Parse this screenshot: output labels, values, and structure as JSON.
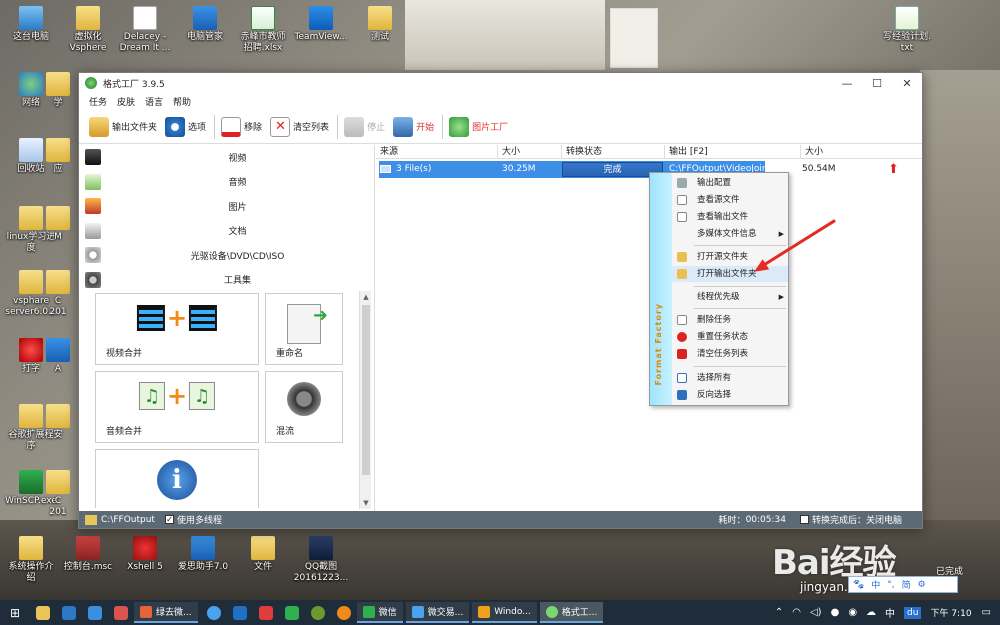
{
  "desktop": {
    "icons": [
      {
        "label": "这台电脑",
        "icon": "computer-icon"
      },
      {
        "label": "虚拟化\nVsphere",
        "icon": "folder-icon"
      },
      {
        "label": "Delacey -\nDream It ...",
        "icon": "mp3-file-icon"
      },
      {
        "label": "电脑管家",
        "icon": "pc-manager-icon"
      },
      {
        "label": "赤峰市教师\n招聘.xlsx",
        "icon": "excel-file-icon"
      },
      {
        "label": "TeamView...",
        "icon": "teamviewer-icon"
      },
      {
        "label": "测试",
        "icon": "folder-icon"
      },
      {
        "label": "写经验计划.\ntxt",
        "icon": "text-file-icon"
      },
      {
        "label": "网络",
        "icon": "network-icon"
      },
      {
        "label": "学",
        "icon": "folder-icon"
      },
      {
        "label": "回收站",
        "icon": "recycle-bin-icon"
      },
      {
        "label": "应",
        "icon": "folder-icon"
      },
      {
        "label": "linux学习进\n度",
        "icon": "folder-icon"
      },
      {
        "label": "M",
        "icon": "folder-icon"
      },
      {
        "label": "vsphare\nserver6.0...",
        "icon": "folder-icon"
      },
      {
        "label": "C\n201",
        "icon": "folder-icon"
      },
      {
        "label": "打字",
        "icon": "typing-app-icon"
      },
      {
        "label": "A",
        "icon": "app-icon"
      },
      {
        "label": "谷歌扩展程\n序",
        "icon": "folder-icon"
      },
      {
        "label": "安",
        "icon": "folder-icon"
      },
      {
        "label": "WinSCP.exe",
        "icon": "winscp-icon"
      },
      {
        "label": "C\n201",
        "icon": "folder-icon"
      },
      {
        "label": "系统操作介\n绍",
        "icon": "folder-icon"
      },
      {
        "label": "控制台.msc",
        "icon": "console-icon"
      },
      {
        "label": "Xshell 5",
        "icon": "xshell-icon"
      },
      {
        "label": "爱思助手7.0",
        "icon": "aisi-icon"
      },
      {
        "label": "文件",
        "icon": "folder-icon"
      },
      {
        "label": "QQ截图\n20161223...",
        "icon": "image-file-icon"
      }
    ]
  },
  "window": {
    "title": "格式工厂 3.9.5",
    "controls": {
      "minimize": "—",
      "maximize": "☐",
      "close": "✕"
    },
    "menu": [
      "任务",
      "皮肤",
      "语言",
      "帮助"
    ],
    "toolbar": {
      "output_folder": "输出文件夹",
      "options": "选项",
      "remove": "移除",
      "clear_list": "清空列表",
      "stop": "停止",
      "start": "开始",
      "picture_factory": "图片工厂"
    },
    "categories": [
      "视频",
      "音频",
      "图片",
      "文档",
      "光驱设备\\DVD\\CD\\ISO",
      "工具集"
    ],
    "tools": [
      {
        "label": "视频合并"
      },
      {
        "label": "重命名"
      },
      {
        "label": "音频合并"
      },
      {
        "label": "混流"
      },
      {
        "label": ""
      }
    ],
    "list": {
      "columns": [
        "来源",
        "大小",
        "转换状态",
        "输出 [F2]",
        "大小"
      ],
      "rows": [
        {
          "source": "3 File(s)",
          "size": "30.25M",
          "status": "完成",
          "output": "C:\\FFOutput\\VideoJoiner1...",
          "output_size": "50.54M"
        }
      ]
    },
    "status_bar": {
      "output_path": "C:\\FFOutput",
      "multithread": "使用多线程",
      "elapsed_label": "耗时：",
      "elapsed": "00:05:34",
      "after_convert": "转换完成后：关闭电脑"
    }
  },
  "context_menu": {
    "brand": "Format Factory",
    "items": [
      {
        "label": "输出配置",
        "icon": "settings-icon"
      },
      {
        "label": "查看源文件",
        "icon": "document-icon"
      },
      {
        "label": "查看输出文件",
        "icon": "document-icon"
      },
      {
        "label": "多媒体文件信息",
        "icon": "none",
        "submenu": true
      },
      {
        "label": "打开源文件夹",
        "icon": "folder-icon"
      },
      {
        "label": "打开输出文件夹",
        "icon": "folder-icon"
      },
      {
        "label": "线程优先级",
        "icon": "none",
        "submenu": true
      },
      {
        "label": "删除任务",
        "icon": "delete-icon"
      },
      {
        "label": "重置任务状态",
        "icon": "reset-icon"
      },
      {
        "label": "清空任务列表",
        "icon": "clear-icon"
      },
      {
        "label": "选择所有",
        "icon": "select-all-icon"
      },
      {
        "label": "反向选择",
        "icon": "invert-select-icon"
      }
    ]
  },
  "watermark": {
    "text": "Bai经验",
    "sub": "jingyan.baidu.com"
  },
  "notification": "已完成",
  "ime": {
    "items": [
      "中",
      "°,",
      "简",
      "⚙"
    ]
  },
  "taskbar": {
    "start": "⊞",
    "pinned": [
      "file-explorer-icon",
      "store-icon",
      "edge-icon",
      "app-icon",
      "app-icon",
      "app-icon",
      "app-icon",
      "app-icon",
      "app-icon",
      "app-icon",
      "app-icon"
    ],
    "tasks": [
      {
        "label": "绿去微...",
        "active": false
      },
      {
        "label": "微信",
        "active": false
      },
      {
        "label": "微交易...",
        "active": false
      },
      {
        "label": "Windo...",
        "active": false
      },
      {
        "label": "格式工...",
        "active": true
      }
    ],
    "tray": {
      "ime": "中",
      "du": "du",
      "time": "下午 7:10"
    }
  },
  "colors": {
    "accent": "#3d8ee6",
    "status_bar": "#5c6a76",
    "arrow": "#e52a24"
  }
}
